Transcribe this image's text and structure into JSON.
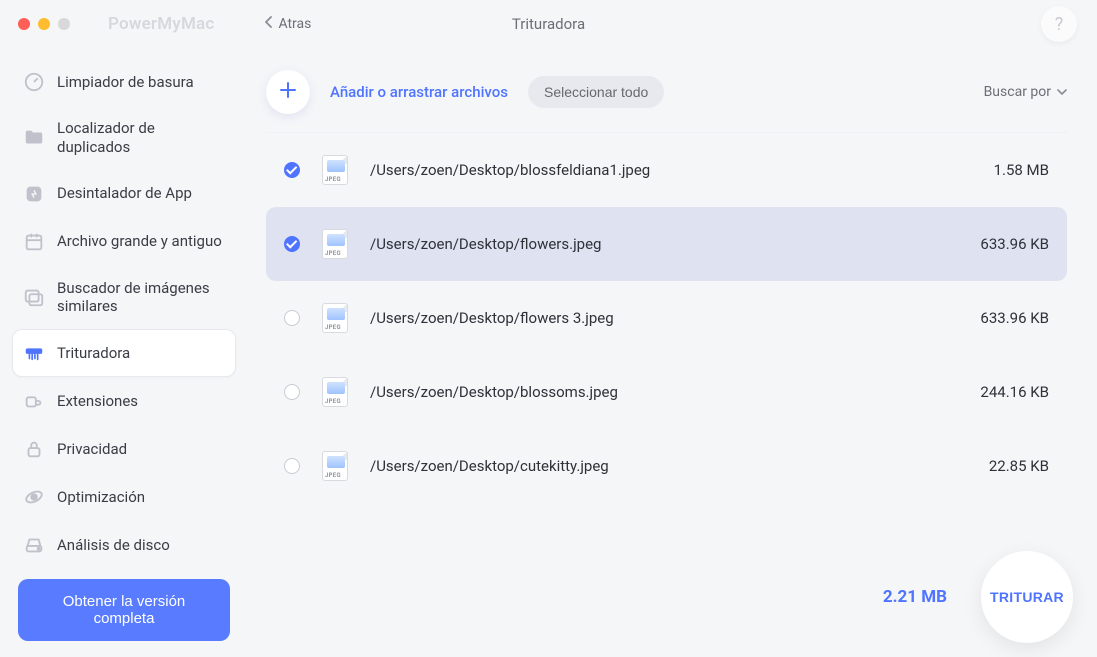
{
  "app_name": "PowerMyMac",
  "back_label": "Atras",
  "page_title": "Trituradora",
  "help_glyph": "?",
  "sidebar": {
    "items": [
      {
        "label": "Limpiador de basura",
        "icon": "meter-icon",
        "active": false
      },
      {
        "label": "Localizador de duplicados",
        "icon": "folder-icon",
        "active": false
      },
      {
        "label": "Desintalador de App",
        "icon": "app-icon",
        "active": false
      },
      {
        "label": "Archivo grande y antiguo",
        "icon": "calendar-icon",
        "active": false
      },
      {
        "label": "Buscador de imágenes similares",
        "icon": "images-icon",
        "active": false
      },
      {
        "label": "Trituradora",
        "icon": "shredder-icon",
        "active": true
      },
      {
        "label": "Extensiones",
        "icon": "puzzle-icon",
        "active": false
      },
      {
        "label": "Privacidad",
        "icon": "lock-icon",
        "active": false
      },
      {
        "label": "Optimización",
        "icon": "orbit-icon",
        "active": false
      },
      {
        "label": "Análisis de disco",
        "icon": "disk-icon",
        "active": false
      }
    ],
    "full_version_label": "Obtener la versión completa"
  },
  "toolbar": {
    "add_label": "Añadir o arrastrar archivos",
    "select_all_label": "Seleccionar todo",
    "sort_label": "Buscar por"
  },
  "files": [
    {
      "path": "/Users/zoen/Desktop/blossfeldiana1.jpeg",
      "size": "1.58 MB",
      "checked": true,
      "highlighted": false,
      "type": "JPEG"
    },
    {
      "path": "/Users/zoen/Desktop/flowers.jpeg",
      "size": "633.96 KB",
      "checked": true,
      "highlighted": true,
      "type": "JPEG"
    },
    {
      "path": "/Users/zoen/Desktop/flowers 3.jpeg",
      "size": "633.96 KB",
      "checked": false,
      "highlighted": false,
      "type": "JPEG"
    },
    {
      "path": "/Users/zoen/Desktop/blossoms.jpeg",
      "size": "244.16 KB",
      "checked": false,
      "highlighted": false,
      "type": "JPEG"
    },
    {
      "path": "/Users/zoen/Desktop/cutekitty.jpeg",
      "size": "22.85 KB",
      "checked": false,
      "highlighted": false,
      "type": "JPEG"
    }
  ],
  "footer": {
    "total_size": "2.21 MB",
    "shred_label": "TRITURAR"
  },
  "colors": {
    "accent": "#4f74ff",
    "accent_btn": "#587bff",
    "muted": "#6b6e77",
    "highlight_row": "#dfe3f1"
  }
}
